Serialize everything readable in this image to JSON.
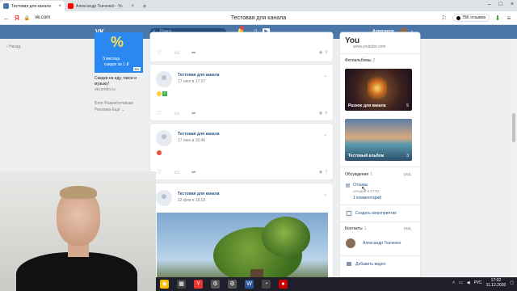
{
  "browser": {
    "tabs": [
      {
        "label": "Тестовая для канала",
        "close": "×"
      },
      {
        "label": "Александр Ткаченко - Yo",
        "close": "×"
      }
    ],
    "new_tab": "+",
    "url": "vk.com",
    "page_title": "Тестовая для канала",
    "reviews_badge": "75K отзывов"
  },
  "vk": {
    "search_placeholder": "Поиск",
    "user_name": "Александр"
  },
  "left": {
    "back_label": "Назад",
    "ad": {
      "percent": "%",
      "line1": "3 месяца",
      "line2": "скидок за 1 ₽",
      "age": "18+",
      "text": "Скидки на еду, такси и музыку!",
      "domain": "vkcombo.ru"
    },
    "footer": [
      "Блог",
      "Разработчикам",
      "Реклама",
      "Ещё"
    ]
  },
  "feed": {
    "posts": [
      {
        "views": "9"
      },
      {
        "name": "Тестовая для канала",
        "date": "17 июн в 17:37",
        "views": "6"
      },
      {
        "name": "Тестовая для канала",
        "date": "17 июн в 16:46",
        "views": "7"
      },
      {
        "name": "Тестовая для канала",
        "date": "12 фев в 18:03"
      }
    ]
  },
  "sidebar": {
    "yt_logo": "You",
    "yt_url": "www.youtube.com",
    "albums_title": "Фотоальбомы",
    "albums_count": "2",
    "albums": [
      {
        "name": "Разное для канала",
        "count": "5"
      },
      {
        "name": "Тестовый альбом",
        "count": "3"
      }
    ],
    "discussions_title": "Обсуждения",
    "discussions_count": "1",
    "edit_label": "ред.",
    "topic": {
      "title": "Отзывы",
      "meta": "сегодня в 17:01",
      "comments": "1 комментарий"
    },
    "create_event": "Создать мероприятие",
    "contacts_title": "Контакты",
    "contacts_count": "1",
    "contact_name": "Александр Ткаченко",
    "add_video": "Добавить видео"
  },
  "taskbar": {
    "lang": "РУС",
    "time": "17:02",
    "date": "11.12.2020"
  },
  "colors": {
    "vk_blue": "#4a76a8",
    "link": "#2a5885"
  }
}
